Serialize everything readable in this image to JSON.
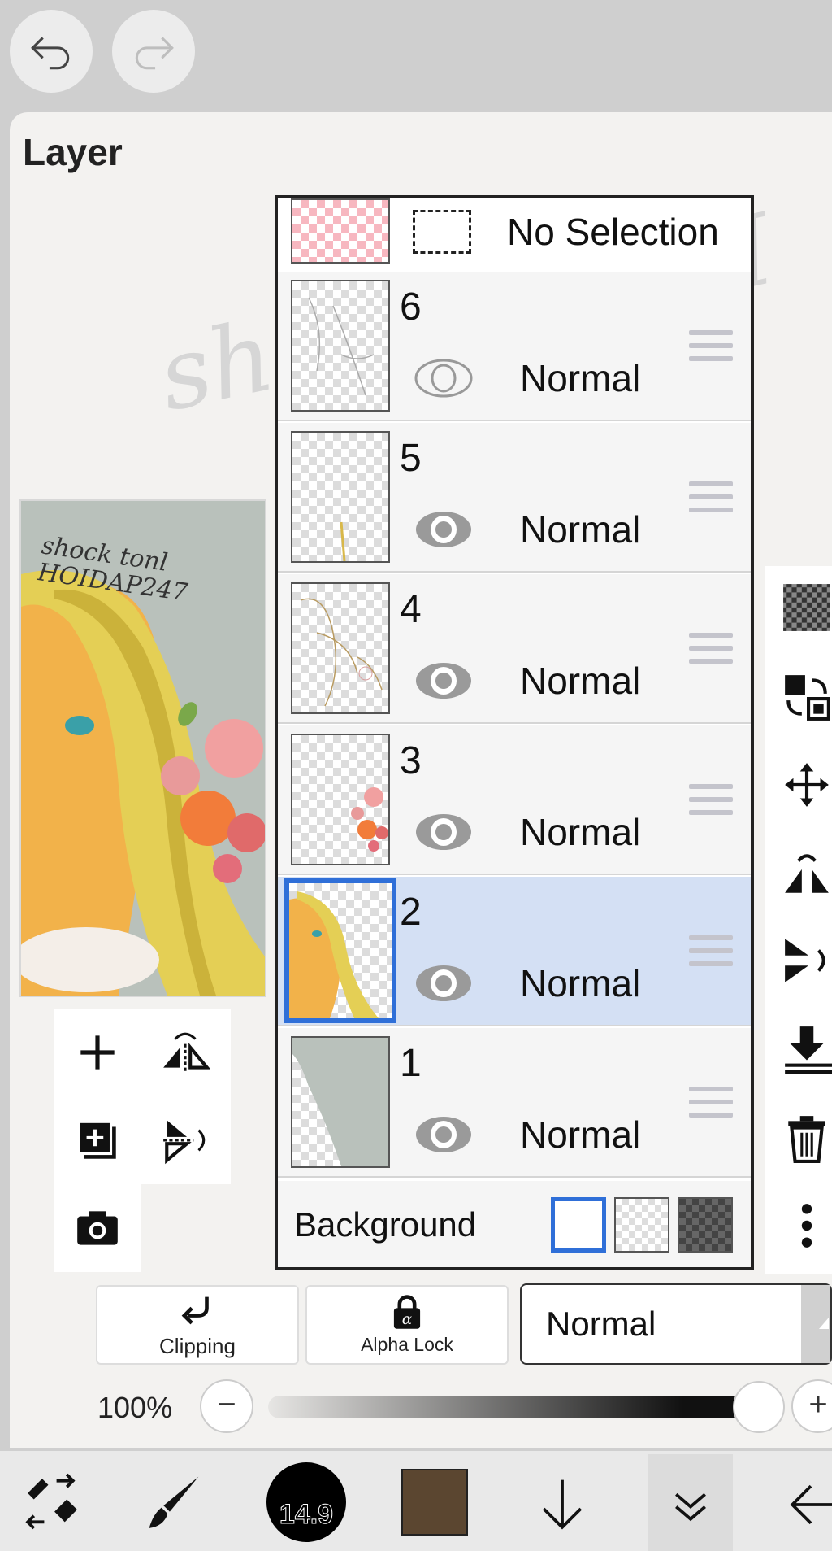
{
  "panel": {
    "title": "Layer",
    "watermark": "shock tonl H"
  },
  "preview": {
    "signature": "shock tonl HOIDAP247"
  },
  "selection_row": {
    "label": "No Selection"
  },
  "layers": [
    {
      "number": "6",
      "blend": "Normal",
      "visible": false,
      "selected": false
    },
    {
      "number": "5",
      "blend": "Normal",
      "visible": true,
      "selected": false
    },
    {
      "number": "4",
      "blend": "Normal",
      "visible": true,
      "selected": false
    },
    {
      "number": "3",
      "blend": "Normal",
      "visible": true,
      "selected": false
    },
    {
      "number": "2",
      "blend": "Normal",
      "visible": true,
      "selected": true
    },
    {
      "number": "1",
      "blend": "Normal",
      "visible": true,
      "selected": false
    }
  ],
  "background_row": {
    "label": "Background",
    "options": [
      "white",
      "transparent",
      "dark-checker"
    ],
    "selected": "white"
  },
  "controls": {
    "clipping_label": "Clipping",
    "alpha_lock_label": "Alpha Lock",
    "blend_mode": "Normal",
    "opacity": "100%",
    "opacity_value": 1.0,
    "minus": "−",
    "plus": "+"
  },
  "toolbar": {
    "brush_size": "14.9",
    "color": "#5b4630"
  },
  "colors": {
    "selection_blue": "#2f6fd8",
    "selected_row": "#d4e0f4"
  }
}
